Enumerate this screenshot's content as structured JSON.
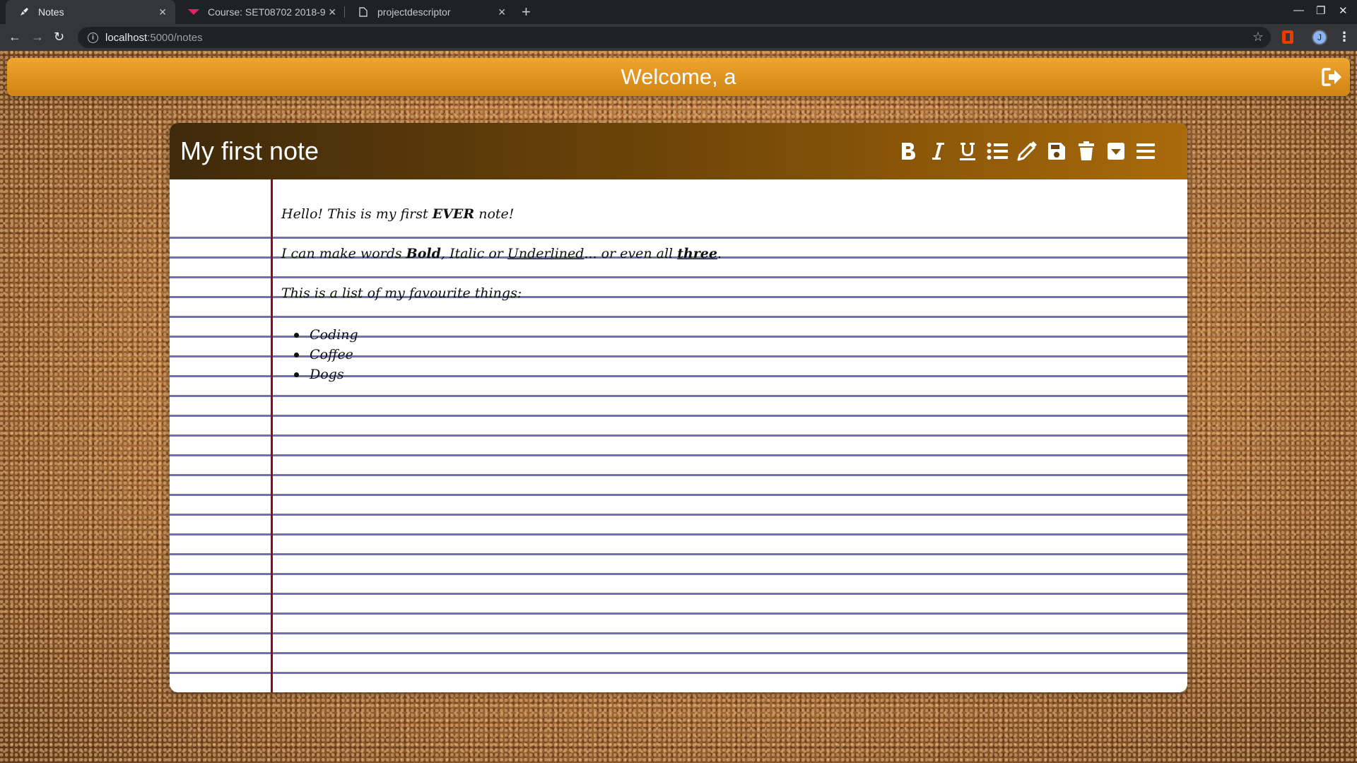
{
  "browser": {
    "tabs": [
      {
        "title": "Notes",
        "active": true
      },
      {
        "title": "Course: SET08702 2018-9 T",
        "active": false
      },
      {
        "title": "projectdescriptor",
        "active": false
      }
    ],
    "url_host": "localhost",
    "url_path": ":5000/notes",
    "profile_initial": "J"
  },
  "app": {
    "welcome_text": "Welcome, a",
    "accent_color": "#e8992a"
  },
  "note": {
    "title": "My first note",
    "tools": [
      "bold-icon",
      "italic-icon",
      "underline-icon",
      "list-icon",
      "pencil-icon",
      "save-icon",
      "trash-icon",
      "dropdown-icon",
      "menu-icon"
    ],
    "content": {
      "line1_a": "Hello! This is my first ",
      "line1_bold": "EVER",
      "line1_b": " note!",
      "line2_a": "I can make words ",
      "line2_bold": "Bold",
      "line2_b": ", ",
      "line2_italic": "Italic",
      "line2_c": " or ",
      "line2_underline": "Underlined",
      "line2_d": "... or even all ",
      "line2_all": "three",
      "line2_e": ".",
      "line3": "This is a list of my favourite things:",
      "list": [
        "Coding",
        "Coffee",
        "Dogs"
      ]
    }
  }
}
